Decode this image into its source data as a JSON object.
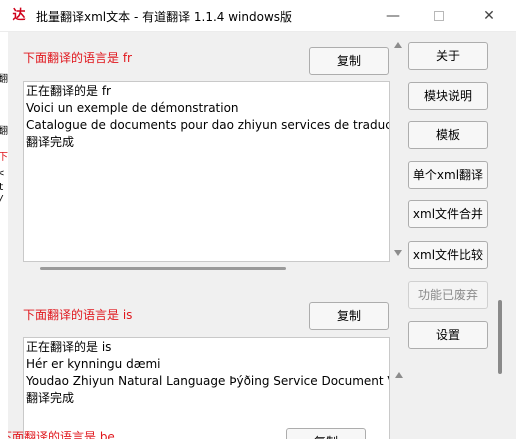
{
  "window": {
    "app_icon_glyph": "达",
    "title": "批量翻译xml文本 - 有道翻译 1.1.4 windows版",
    "minimize_glyph": "—",
    "close_glyph": "✕"
  },
  "background_window": {
    "fragments": [
      "翻",
      "翻",
      "下",
      "<",
      "t",
      "/"
    ]
  },
  "sections": [
    {
      "label": "下面翻译的语言是 fr",
      "copy_label": "复制",
      "lines": [
        "正在翻译的是 fr",
        "Voici un exemple de démonstration",
        "Catalogue de documents pour dao zhiyun services de traductio",
        "翻译完成"
      ]
    },
    {
      "label": "下面翻译的语言是 is",
      "copy_label": "复制",
      "lines": [
        "正在翻译的是 is",
        "Hér er kynningu dæmi",
        "Youdao Zhiyun Natural Language Þýðing Service Document Vö",
        "翻译完成"
      ]
    },
    {
      "label": "下面翻译的语言是 be",
      "copy_label": "复制"
    }
  ],
  "sidebar": {
    "buttons": [
      {
        "label": "关于",
        "enabled": true
      },
      {
        "label": "模块说明",
        "enabled": true
      },
      {
        "label": "模板",
        "enabled": true
      },
      {
        "label": "单个xml翻译",
        "enabled": true
      },
      {
        "label": "xml文件合并",
        "enabled": true
      },
      {
        "label": "xml文件比较",
        "enabled": true
      },
      {
        "label": "功能已废弃",
        "enabled": false
      },
      {
        "label": "设置",
        "enabled": true
      }
    ]
  },
  "colors": {
    "label_red": "#e0151b",
    "window_bg": "#f0f0f0",
    "button_bg": "#f7f7f7",
    "disabled_text": "#8a8a8a"
  }
}
